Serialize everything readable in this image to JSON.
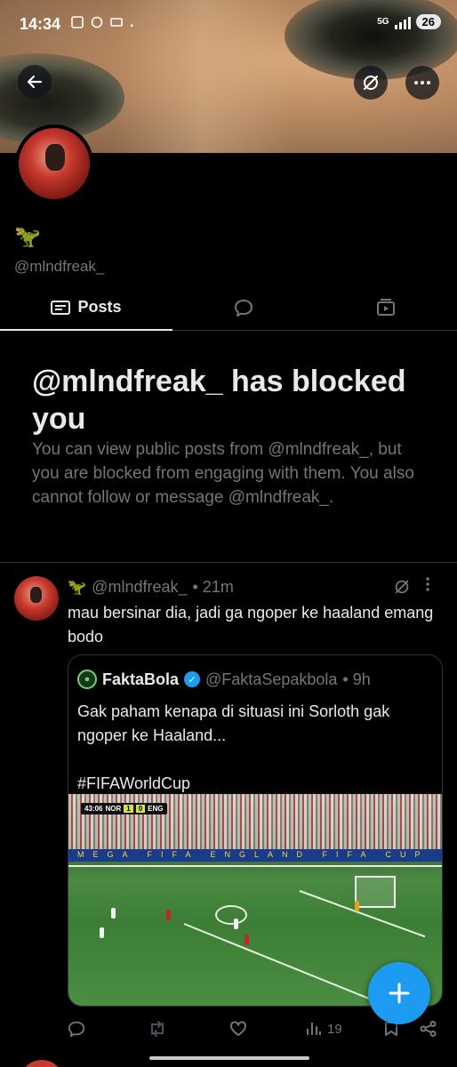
{
  "status_bar": {
    "time": "14:34",
    "network": "5G",
    "battery": "26"
  },
  "profile": {
    "display_name_emoji": "🦖",
    "handle": "@mlndfreak_"
  },
  "tabs": [
    {
      "label": "Posts",
      "icon": "posts-icon"
    },
    {
      "label": "",
      "icon": "replies-icon"
    },
    {
      "label": "",
      "icon": "media-icon"
    }
  ],
  "blocked": {
    "title": "@mlndfreak_ has blocked you",
    "description": "You can view public posts from @mlndfreak_, but you are blocked from engaging with them. You also cannot follow or message @mlndfreak_."
  },
  "post": {
    "emoji": "🦖",
    "handle": "@mlndfreak_",
    "time": "• 21m",
    "text": "mau bersinar dia, jadi ga ngoper ke haaland emang bodo",
    "quote": {
      "name": "FaktaBola",
      "handle": "@FaktaSepakbola",
      "time": "• 9h",
      "text": "Gak paham kenapa di situasi ini Sorloth gak ngoper ke Haaland...\n\n#FIFAWorldCup",
      "scorebug": {
        "clock": "43:06",
        "home": "NOR",
        "home_score": "1",
        "away_score": "0",
        "away": "ENG"
      }
    },
    "views": "19"
  },
  "colors": {
    "accent": "#1d9bf0",
    "text": "#e7e9ea",
    "muted": "#71767b",
    "border": "#2f3336",
    "background": "#000000"
  }
}
